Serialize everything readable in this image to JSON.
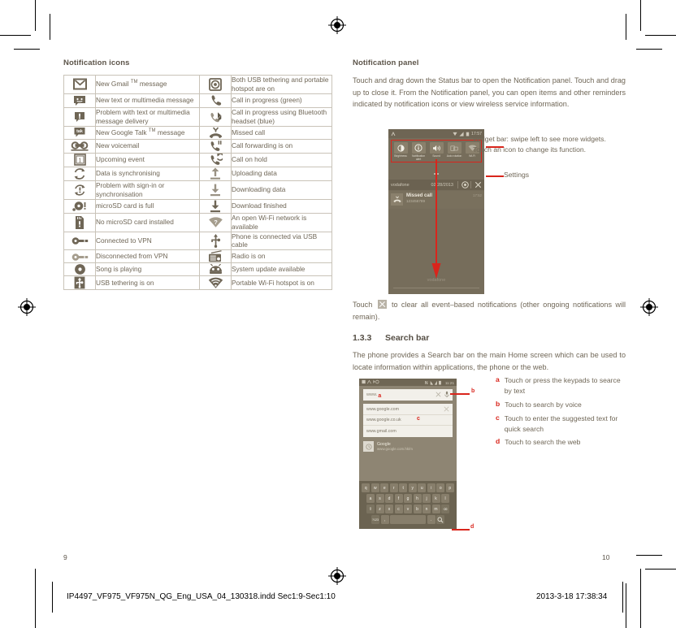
{
  "left": {
    "section_title": "Notification icons",
    "rows": [
      {
        "icon_l": "gmail-icon",
        "text_l": "New Gmail ™ message",
        "icon_r": "usb-tethering-hotspot-icon",
        "text_r": "Both USB tethering and portable hotspot are on"
      },
      {
        "icon_l": "sms-message-icon",
        "text_l": "New text or multimedia message",
        "icon_r": "call-in-progress-icon",
        "text_r": "Call in progress (green)"
      },
      {
        "icon_l": "message-problem-icon",
        "text_l": "Problem with text or multimedia message delivery",
        "icon_r": "call-bluetooth-icon",
        "text_r": "Call in progress using Bluetooth headset (blue)"
      },
      {
        "icon_l": "google-talk-icon",
        "text_l": "New Google Talk ™ message",
        "icon_r": "missed-call-icon",
        "text_r": "Missed call"
      },
      {
        "icon_l": "voicemail-icon",
        "text_l": "New voicemail",
        "icon_r": "call-on-hold-icon",
        "text_r": "Call on hold"
      },
      {
        "icon_l": "calendar-event-icon",
        "text_l": "Upcoming event",
        "icon_r": "call-forwarding-icon",
        "text_r": "Call forwarding is on"
      },
      {
        "icon_l": "sync-icon",
        "text_l": "Data is synchronising",
        "icon_r": "upload-icon",
        "text_r": "Uploading data"
      },
      {
        "icon_l": "sync-problem-icon",
        "text_l": "Problem with sign-in or synchronisation",
        "icon_r": "download-icon",
        "text_r": "Downloading data"
      },
      {
        "icon_l": "sdcard-full-icon",
        "text_l": "microSD card is full",
        "icon_r": "download-finished-icon",
        "text_r": "Download finished"
      },
      {
        "icon_l": "no-sdcard-icon",
        "text_l": "No microSD card installed",
        "icon_r": "open-wifi-icon",
        "text_r": "An open Wi-Fi network is available"
      },
      {
        "icon_l": "vpn-connected-icon",
        "text_l": "Connected to VPN",
        "icon_r": "usb-cable-icon",
        "text_r": "Phone is connected via USB cable"
      },
      {
        "icon_l": "vpn-disconnected-icon",
        "text_l": "Disconnected from VPN",
        "icon_r": "radio-icon",
        "text_r": "Radio is on"
      },
      {
        "icon_l": "music-playing-icon",
        "text_l": "Song is playing",
        "icon_r": "system-update-icon",
        "text_r": "System update available"
      },
      {
        "icon_l": "usb-tethering-icon",
        "text_l": "USB tethering is on",
        "icon_r": "wifi-hotspot-icon",
        "text_r": "Portable Wi-Fi hotspot is on"
      }
    ]
  },
  "right": {
    "section_title": "Notification panel",
    "intro": "Touch and drag down the Status bar to open the Notification panel. Touch and drag up to close it. From the Notification panel, you can open items and other reminders indicated by notification icons or view wireless service information.",
    "clear_text_before": "Touch",
    "clear_text_after": "to clear all event–based notifications (other ongoing notifications will remain).",
    "callouts": {
      "widget_bar": "Widget bar: swipe left to see more widgets. Touch an icon to change its function.",
      "settings": "Settings"
    },
    "subsection": {
      "number": "1.3.3",
      "title": "Search bar"
    },
    "search_intro": "The phone provides a Search bar on the main Home screen which can be used to locate information within applications, the phone or the web.",
    "legend": [
      {
        "mark": "a",
        "text": "Touch or press the keypads to searce by text"
      },
      {
        "mark": "b",
        "text": "Touch to search by voice"
      },
      {
        "mark": "c",
        "text": "Touch to enter the suggested text for quick search"
      },
      {
        "mark": "d",
        "text": "Touch to search the web"
      }
    ]
  },
  "phone1": {
    "status_time": "17:57",
    "widgets": [
      {
        "icon": "brightness-icon",
        "label": "Brightness"
      },
      {
        "icon": "notification-alert-icon",
        "label": "Notification alert"
      },
      {
        "icon": "sound-icon",
        "label": "Sound"
      },
      {
        "icon": "auto-rotation-icon",
        "label": "Auto rotation"
      },
      {
        "icon": "wifi-icon",
        "label": "Wi-Fi"
      }
    ],
    "carrier": "vodafone",
    "date": "02/28/2013",
    "notification": {
      "title": "Missed call",
      "number": "123456789",
      "time": "17:52"
    },
    "watermark": "vodafone"
  },
  "phone2": {
    "status_time": "11:21",
    "search_value": "www.",
    "suggestions": [
      "www.google.com",
      "www.google.co.uk",
      "www.gmail.com"
    ],
    "google_box": {
      "title": "Google",
      "url": "www.google.com.hk/m"
    },
    "keyboard": {
      "row1": [
        "q",
        "w",
        "e",
        "r",
        "t",
        "y",
        "u",
        "i",
        "o",
        "p"
      ],
      "row2": [
        "a",
        "s",
        "d",
        "f",
        "g",
        "h",
        "j",
        "k",
        "l"
      ],
      "row3": [
        "z",
        "x",
        "c",
        "v",
        "b",
        "n",
        "m"
      ],
      "shift": "⇧",
      "backspace": "⌫",
      "numsym": "?123",
      "comma": ",",
      "period": ".",
      "search": "search-icon"
    },
    "markers": [
      "a",
      "b",
      "c",
      "d"
    ]
  },
  "footer": {
    "page_left": "9",
    "page_right": "10",
    "file": "IP4497_VF975_VF975N_QG_Eng_USA_04_130318.indd   Sec1:9-Sec1:10",
    "timestamp": "2013-3-18   17:38:34"
  },
  "colors": {
    "text": "#6f6656",
    "rule": "#c9c3b8",
    "accent_red": "#d9251c",
    "phone_bg": "#766d5b"
  }
}
